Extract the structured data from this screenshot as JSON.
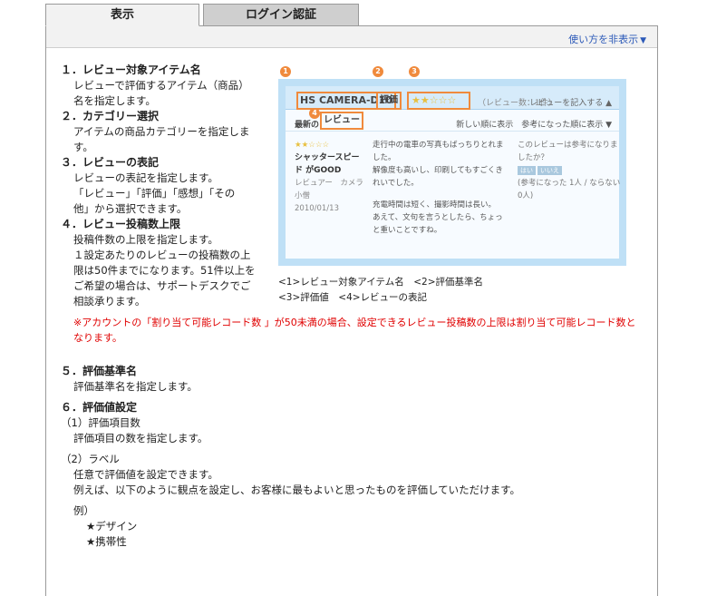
{
  "tabs": [
    {
      "label": "表示",
      "active": true
    },
    {
      "label": "ログイン認証",
      "active": false
    }
  ],
  "help_toggle": {
    "label": "使い方を非表示",
    "arrow": "▼"
  },
  "sections": [
    {
      "heading": "１．レビュー対象アイテム名",
      "lines": [
        "レビューで評価するアイテム（商品）",
        "名を指定します。"
      ]
    },
    {
      "heading": "２．カテゴリー選択",
      "lines": [
        "アイテムの商品カテゴリーを指定しま",
        "す。"
      ]
    },
    {
      "heading": "３．レビューの表記",
      "lines": [
        "レビューの表記を指定します。",
        "「レビュー」「評価」「感想」「その",
        "他」から選択できます。"
      ]
    },
    {
      "heading": "４．レビュー投稿数上限",
      "lines": [
        "投稿件数の上限を指定します。",
        "１設定あたりのレビューの投稿数の上",
        "限は50件までになります。51件以上を",
        "ご希望の場合は、サポートデスクでご",
        "相談承ります。"
      ]
    }
  ],
  "note": "※アカウントの「割り当て可能レコード数 」が50未満の場合、設定できるレビュー投稿数の上限は割り当て可能レコード数となります。",
  "section5": {
    "heading": "５．評価基準名",
    "line": "評価基準名を指定します。"
  },
  "section6": {
    "heading": "６．評価値設定",
    "sub1": "（1）評価項目数",
    "sub1_line": "評価項目の数を指定します。",
    "sub2": "（2）ラベル",
    "sub2_lines": [
      "任意で評価値を設定できます。",
      "例えば、以下のように観点を設定し、お客様に最もよいと思ったものを評価していただけます。"
    ],
    "example_label": "例）",
    "examples": [
      "★デザイン",
      "★携帯性"
    ]
  },
  "preview": {
    "item_name": "HS CAMERA-D10",
    "rating_label": "評価",
    "stars": "★★☆☆☆",
    "count": "（レビュー数：1件）",
    "write": "レビューを記入する ▲",
    "newest": "最新の",
    "review_label": "レビュー",
    "sort": "新しい順に表示　参考になった順に表示 ▼",
    "review_stars": "★★☆☆☆",
    "review_title": "シャッタースピード がGOOD",
    "reviewer": "レビュアー　カメラ小僧",
    "date": "2010/01/13",
    "review_text": [
      "走行中の電車の写真もばっちりとれました。",
      "解像度も高いし、印刷してもすごくきれいでした。",
      "",
      "充電時間は短く、撮影時間は長い。",
      "あえて、文句を言うとしたら、ちょっと重いことですね。"
    ],
    "helpful_q": "このレビューは参考になりましたか？",
    "yes": "はい",
    "no": "いいえ",
    "helpful_count": "(参考になった 1人 / ならない 0人)",
    "badges": [
      "1",
      "2",
      "3",
      "4"
    ]
  },
  "caption": [
    "<1>レビュー対象アイテム名　<2>評価基準名",
    "<3>評価値　<4>レビューの表記"
  ]
}
